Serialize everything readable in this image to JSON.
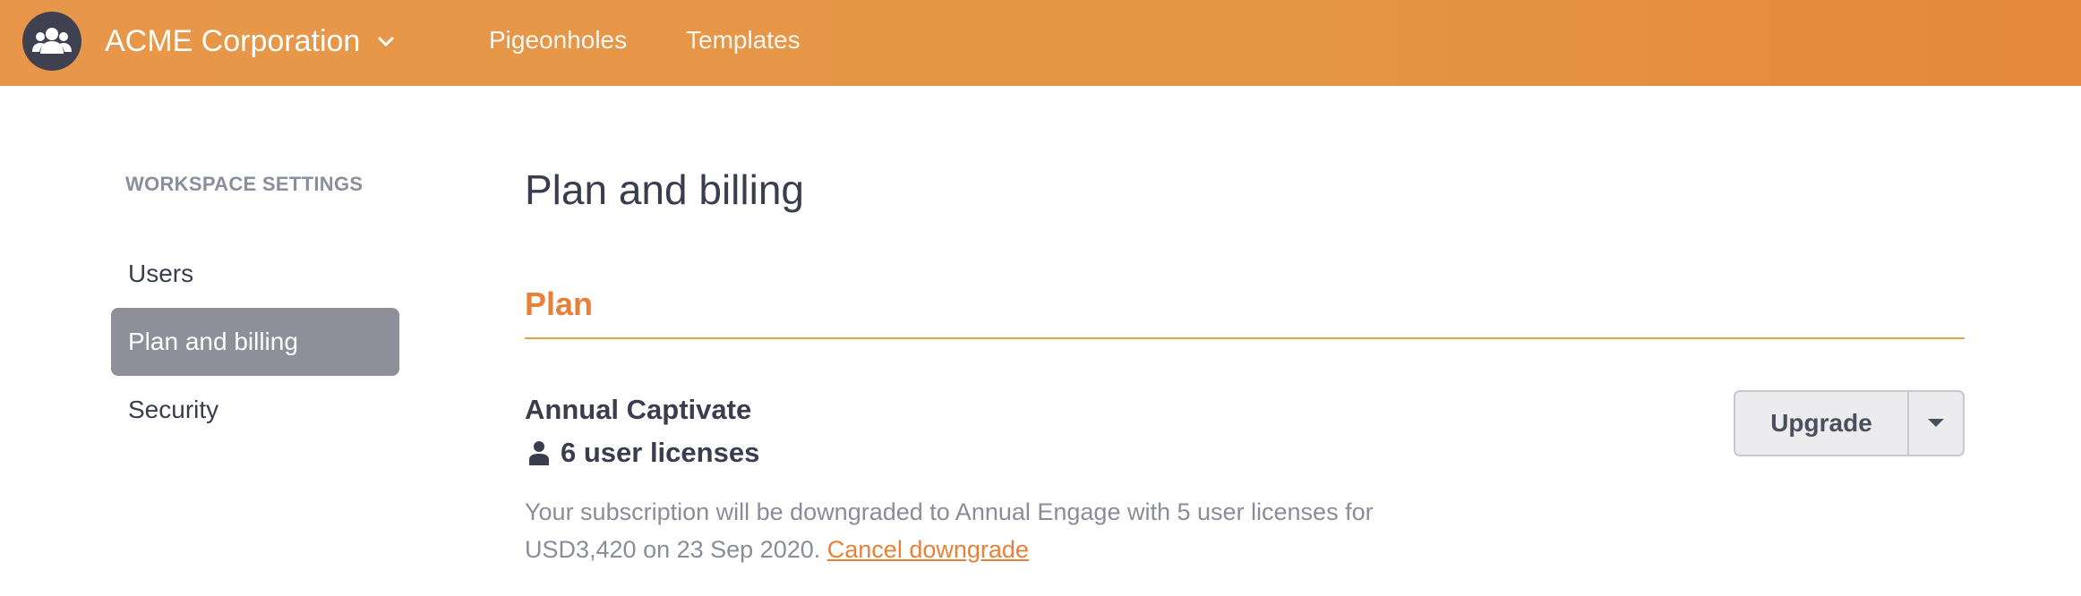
{
  "topbar": {
    "workspace_name": "ACME Corporation",
    "nav": [
      {
        "label": "Pigeonholes"
      },
      {
        "label": "Templates"
      }
    ],
    "accent_color": "#e8974a"
  },
  "sidebar": {
    "heading": "WORKSPACE SETTINGS",
    "items": [
      {
        "label": "Users",
        "active": false
      },
      {
        "label": "Plan and billing",
        "active": true
      },
      {
        "label": "Security",
        "active": false
      }
    ]
  },
  "main": {
    "title": "Plan and billing",
    "section_title": "Plan",
    "plan_name": "Annual Captivate",
    "licenses": "6 user licenses",
    "note_text": "Your subscription will be downgraded to Annual Engage with 5 user licenses for USD3,420 on 23 Sep 2020. ",
    "note_link": "Cancel downgrade",
    "upgrade_label": "Upgrade"
  },
  "icons": {
    "workspace_avatar": "group-users-icon",
    "workspace_dropdown": "chevron-down-icon",
    "license": "user-icon",
    "upgrade_menu": "caret-down-icon"
  }
}
